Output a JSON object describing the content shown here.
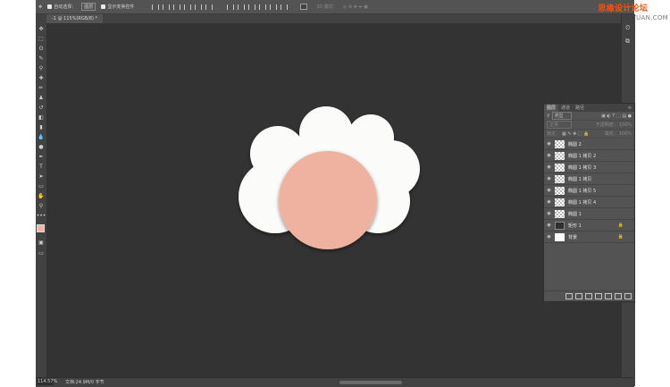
{
  "options_bar": {
    "auto_select_label": "自动选择：",
    "auto_select_value": "图层",
    "show_transform_label": "显示变换控件",
    "mode_3d_label": "3D 模式："
  },
  "watermark": {
    "main": "思缘设计论坛",
    "site": "www.MISSYUAN.COM"
  },
  "document": {
    "tab_title": "-1 @ 115%(RGB/8) *"
  },
  "layers_panel": {
    "tabs": [
      {
        "label": "图层",
        "active": true
      },
      {
        "label": "通道",
        "active": false
      },
      {
        "label": "路径",
        "active": false
      }
    ],
    "filter_kind": "类型",
    "blend_mode": "正常",
    "opacity_label": "不透明度：",
    "opacity_value": "100%",
    "lock_label": "锁定：",
    "fill_label": "填充：",
    "fill_value": "100%",
    "layers": [
      {
        "name": "椭圆 2",
        "thumb": "transparent",
        "locked": false
      },
      {
        "name": "椭圆 1 拷贝 2",
        "thumb": "transparent",
        "locked": false
      },
      {
        "name": "椭圆 1 拷贝 3",
        "thumb": "transparent",
        "locked": false
      },
      {
        "name": "椭圆 1 拷贝",
        "thumb": "transparent",
        "locked": false
      },
      {
        "name": "椭圆 1 拷贝 5",
        "thumb": "transparent",
        "locked": false
      },
      {
        "name": "椭圆 1 拷贝 4",
        "thumb": "transparent",
        "locked": false
      },
      {
        "name": "椭圆 1",
        "thumb": "transparent",
        "locked": false
      },
      {
        "name": "矩形 1",
        "thumb": "dark",
        "locked": true
      },
      {
        "name": "背景",
        "thumb": "white",
        "locked": true
      }
    ]
  },
  "status_bar": {
    "zoom": "114.57%",
    "doc_info": "文档:24.9M/0 字节"
  },
  "artwork": {
    "cloud_color": "#fbfbf9",
    "circle_color": "#efb2a0",
    "canvas_color": "#343334"
  },
  "foreground_color": "#f0b5a6",
  "background_color": "#1a1a1a"
}
